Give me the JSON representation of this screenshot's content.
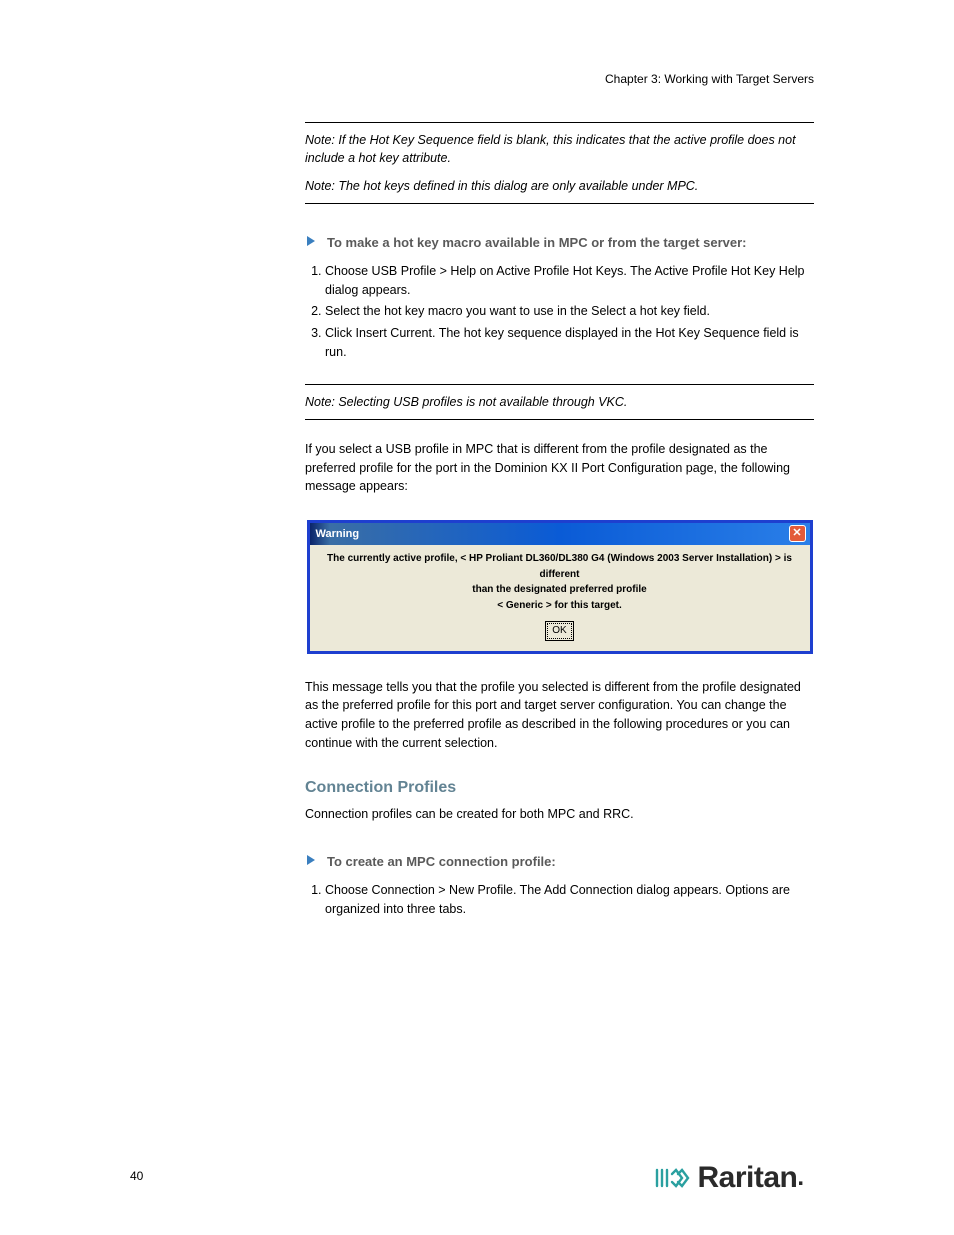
{
  "header": {
    "chapter": "Chapter 3: Working with Target Servers"
  },
  "note1": {
    "line1": "Note: If the Hot Key Sequence field is blank, this indicates that the active profile does not include a hot key attribute.",
    "line2": "Note: The hot keys defined in this dialog are only available under MPC."
  },
  "step1": {
    "heading": "To make a hot key macro available in MPC or from the target server:",
    "items": [
      "Choose USB Profile > Help on Active Profile Hot Keys. The Active Profile Hot Key Help dialog appears.",
      "Select the hot key macro you want to use in the Select a hot key field.",
      "Click Insert Current. The hot key sequence displayed in the Hot Key Sequence field is run."
    ]
  },
  "note2": {
    "text": "Note: Selecting USB profiles is not available through VKC."
  },
  "para1": "If you select a USB profile in MPC that is different from the profile designated as the preferred profile for the port in the Dominion KX II Port Configuration page, the following message appears:",
  "dialog": {
    "title": "Warning",
    "message_line1": "The currently active profile, < HP Proliant DL360/DL380 G4 (Windows 2003 Server Installation) > is different",
    "message_line2": "than the designated preferred profile",
    "message_line3": "< Generic > for this target.",
    "ok_label": "OK",
    "close_glyph": "✕"
  },
  "para2": "This message tells you that the profile you selected is different from the profile designated as the preferred profile for this port and target server configuration. You can change the active profile to the preferred profile as described in the following procedures or you can continue with the current selection.",
  "section": {
    "title": "Connection Profiles",
    "intro": "Connection profiles can be created for both MPC and RRC."
  },
  "step2": {
    "heading": "To create an MPC connection profile:",
    "items": [
      "Choose Connection > New Profile. The Add Connection dialog appears. Options are organized into three tabs."
    ]
  },
  "page_number": "40",
  "logo": {
    "name": "Raritan"
  }
}
